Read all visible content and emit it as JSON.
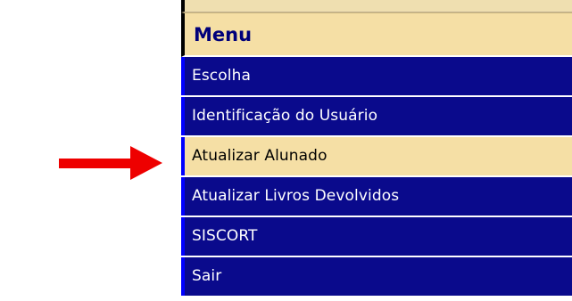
{
  "menu": {
    "title": "Menu",
    "items": [
      {
        "label": "Escolha",
        "highlighted": false
      },
      {
        "label": "Identificação do Usuário",
        "highlighted": false
      },
      {
        "label": "Atualizar Alunado",
        "highlighted": true
      },
      {
        "label": "Atualizar Livros Devolvidos",
        "highlighted": false
      },
      {
        "label": "SISCORT",
        "highlighted": false
      },
      {
        "label": "Sair",
        "highlighted": false
      }
    ]
  },
  "annotation": {
    "arrow_icon": "right-arrow-icon",
    "arrow_color": "#ee0000"
  },
  "colors": {
    "menu_item_bg": "#0a0a8c",
    "menu_header_bg": "#f5dfa5",
    "highlight_bg": "#f5dfa5",
    "header_text": "#00007a"
  }
}
